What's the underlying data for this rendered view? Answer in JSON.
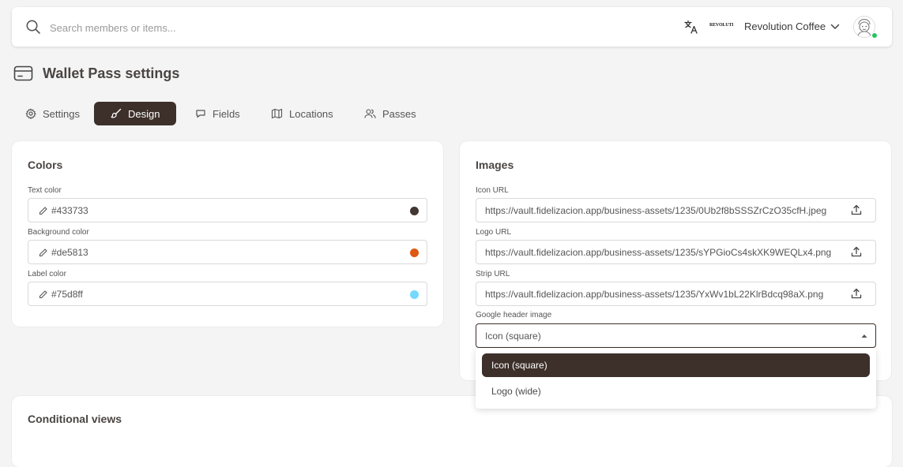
{
  "header": {
    "search_placeholder": "Search members or items...",
    "brand_logo_text": "REVOLUTION",
    "account_name": "Revolution Coffee",
    "online_status_color": "#22c55e"
  },
  "page": {
    "title": "Wallet Pass settings"
  },
  "tabs": [
    {
      "label": "Settings",
      "icon": "gear-icon",
      "active": false
    },
    {
      "label": "Design",
      "icon": "brush-icon",
      "active": true
    },
    {
      "label": "Fields",
      "icon": "chat-icon",
      "active": false
    },
    {
      "label": "Locations",
      "icon": "map-icon",
      "active": false
    },
    {
      "label": "Passes",
      "icon": "users-icon",
      "active": false
    }
  ],
  "colors_card": {
    "title": "Colors",
    "fields": [
      {
        "label": "Text color",
        "value": "#433733",
        "swatch": "#433733"
      },
      {
        "label": "Background color",
        "value": "#de5813",
        "swatch": "#de5813"
      },
      {
        "label": "Label color",
        "value": "#75d8ff",
        "swatch": "#75d8ff"
      }
    ]
  },
  "images_card": {
    "title": "Images",
    "fields": [
      {
        "label": "Icon URL",
        "value": "https://vault.fidelizacion.app/business-assets/1235/0Ub2f8bSSSZrCzO35cfH.jpeg"
      },
      {
        "label": "Logo URL",
        "value": "https://vault.fidelizacion.app/business-assets/1235/sYPGioCs4skXK9WEQLx4.png"
      },
      {
        "label": "Strip URL",
        "value": "https://vault.fidelizacion.app/business-assets/1235/YxWv1bL22KlrBdcq98aX.png"
      }
    ],
    "google_header": {
      "label": "Google header image",
      "value": "Icon (square)",
      "options": [
        {
          "label": "Icon (square)",
          "selected": true
        },
        {
          "label": "Logo (wide)",
          "selected": false
        }
      ]
    }
  },
  "conditional_card": {
    "title": "Conditional views"
  },
  "theme": {
    "accent": "#3d302a",
    "background": "#f4f4f5"
  }
}
